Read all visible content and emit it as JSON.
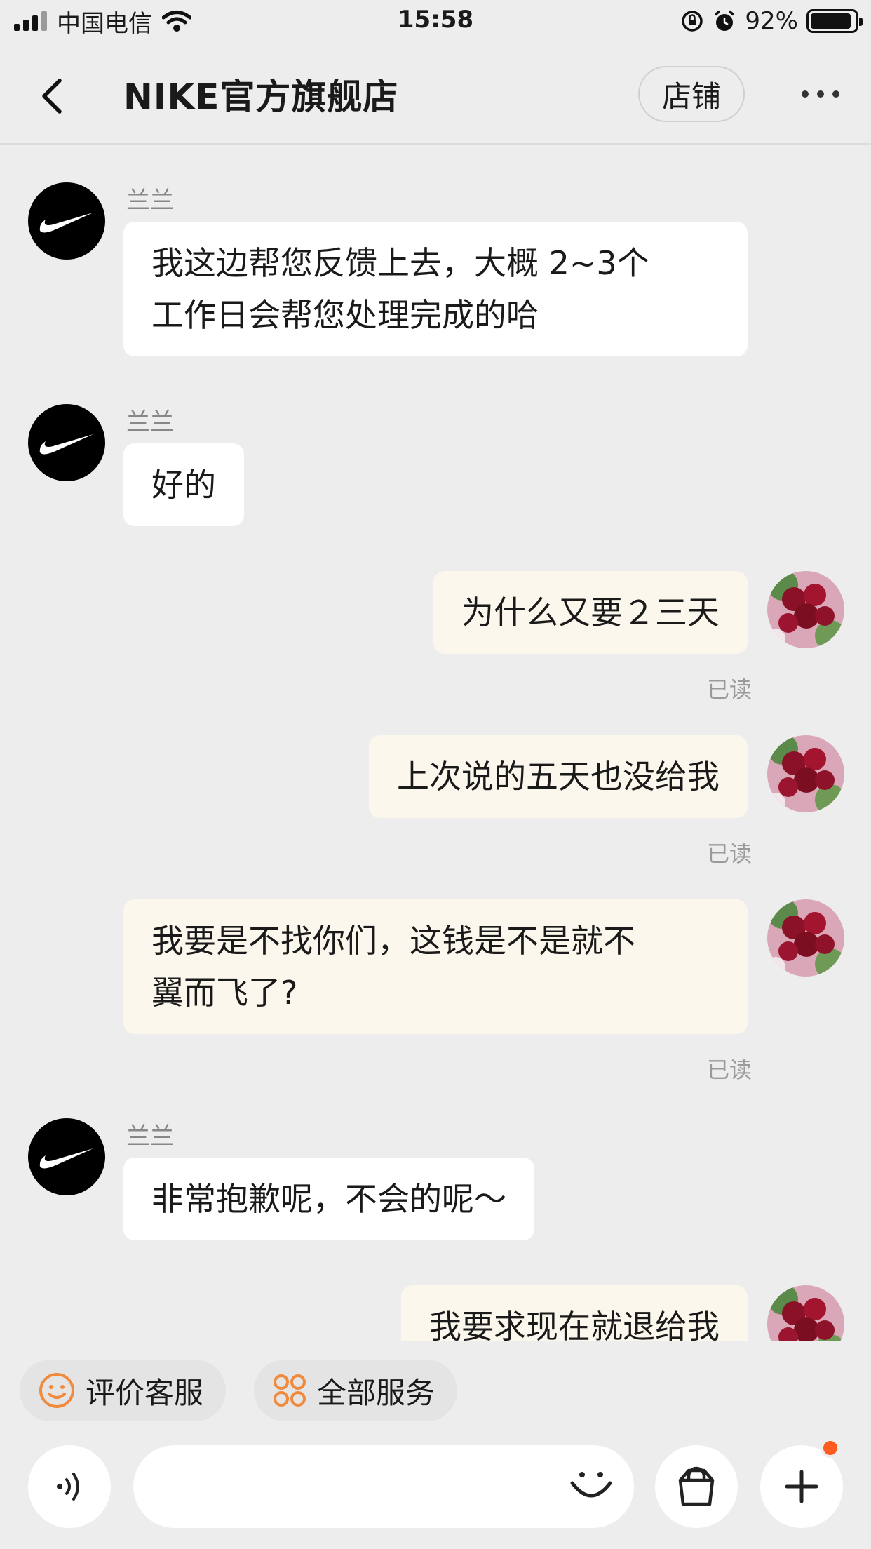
{
  "status_bar": {
    "carrier": "中国电信",
    "time": "15:58",
    "battery": "92%",
    "battery_level": 0.92
  },
  "header": {
    "title": "NIKE官方旗舰店",
    "shop_button": "店铺"
  },
  "messages": [
    {
      "sender": "兰兰",
      "text_lines": [
        "我这边帮您反馈上去，大概 2~3个",
        "工作日会帮您处理完成的哈"
      ]
    },
    {
      "sender": "兰兰",
      "text": "好的"
    },
    {
      "text": "为什么又要２三天",
      "status": "已读"
    },
    {
      "text": "上次说的五天也没给我",
      "status": "已读"
    },
    {
      "text_lines": [
        "我要是不找你们，这钱是不是就不",
        "翼而飞了?"
      ],
      "status": "已读"
    },
    {
      "sender": "兰兰",
      "text": "非常抱歉呢，不会的呢～"
    },
    {
      "text": "我要求现在就退给我"
    }
  ],
  "quick_actions": {
    "rate": "评价客服",
    "all_services": "全部服务"
  },
  "input": {
    "placeholder": ""
  },
  "colors": {
    "background": "#ededed",
    "incoming_bubble": "#ffffff",
    "outgoing_bubble": "#fbf7ec",
    "accent": "#ff5a1f",
    "rate_icon": "#f08a3c"
  }
}
